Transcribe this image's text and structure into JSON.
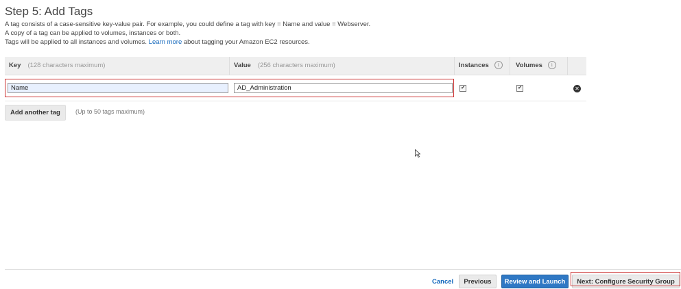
{
  "page": {
    "title": "Step 5: Add Tags",
    "desc1": "A tag consists of a case-sensitive key-value pair. For example, you could define a tag with key = Name and value = Webserver.",
    "desc2": "A copy of a tag can be applied to volumes, instances or both.",
    "desc3_before": "Tags will be applied to all instances and volumes.",
    "desc3_link": "Learn more",
    "desc3_after": "about tagging your Amazon EC2 resources."
  },
  "table": {
    "headers": {
      "key": "Key",
      "key_hint": "(128 characters maximum)",
      "value": "Value",
      "value_hint": "(256 characters maximum)",
      "instances": "Instances",
      "volumes": "Volumes",
      "info_icon": "i"
    },
    "rows": [
      {
        "key": "Name",
        "value": "AD_Administration",
        "instances": "✔",
        "volumes": "✔",
        "remove_icon": "✕"
      }
    ]
  },
  "actions": {
    "add_tag": "Add another tag",
    "add_tag_hint": "(Up to 50 tags maximum)"
  },
  "footer": {
    "cancel": "Cancel",
    "previous": "Previous",
    "review": "Review and Launch",
    "next": "Next: Configure Security Group"
  },
  "colors": {
    "accent": "#2f78c4",
    "highlight": "#cc3333",
    "link": "#1166bb"
  }
}
